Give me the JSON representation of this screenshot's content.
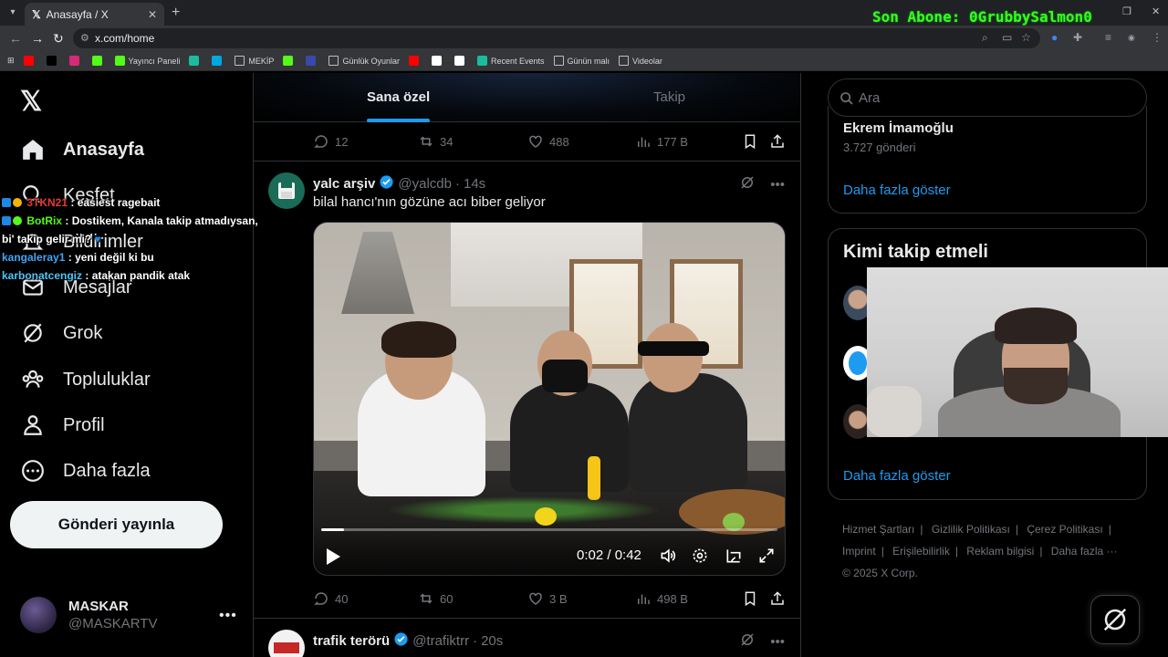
{
  "browser": {
    "tab_title": "Anasayfa / X",
    "url": "x.com/home",
    "overlay_text": "Son Abone: 0GrubbySalmon0",
    "bookmarks": [
      {
        "icon": "youtube-icon",
        "label": "",
        "color": "#ff0000"
      },
      {
        "icon": "x-icon",
        "label": "",
        "color": "#000000"
      },
      {
        "icon": "instagram-icon",
        "label": "",
        "color": "#d62976"
      },
      {
        "icon": "kick-icon",
        "label": "",
        "color": "#53fc18"
      },
      {
        "icon": "kick-icon",
        "label": "Yayıncı Paneli",
        "color": "#53fc18"
      },
      {
        "icon": "app-icon",
        "label": "",
        "color": "#1abc9c"
      },
      {
        "icon": "prime-icon",
        "label": "",
        "color": "#00a8e1"
      },
      {
        "icon": "folder-icon",
        "label": "MEKİP",
        "color": "#bdbdbd"
      },
      {
        "icon": "kick-icon",
        "label": "",
        "color": "#53fc18"
      },
      {
        "icon": "app-icon",
        "label": "",
        "color": "#3949ab"
      },
      {
        "icon": "folder-icon",
        "label": "Günlük Oyunlar",
        "color": "#bdbdbd"
      },
      {
        "icon": "youtube-icon",
        "label": "",
        "color": "#ff0000"
      },
      {
        "icon": "image-icon",
        "label": "",
        "color": "#ffffff"
      },
      {
        "icon": "openai-icon",
        "label": "",
        "color": "#ffffff"
      },
      {
        "icon": "app-icon",
        "label": "Recent Events",
        "color": "#1abc9c"
      },
      {
        "icon": "folder-icon",
        "label": "Günün malı",
        "color": "#bdbdbd"
      },
      {
        "icon": "folder-icon",
        "label": "Videolar",
        "color": "#bdbdbd"
      }
    ]
  },
  "nav": {
    "items": [
      {
        "label": "Anasayfa",
        "icon": "home-icon"
      },
      {
        "label": "Keşfet",
        "icon": "search-icon"
      },
      {
        "label": "Bildirimler",
        "icon": "bell-icon"
      },
      {
        "label": "Mesajlar",
        "icon": "mail-icon"
      },
      {
        "label": "Grok",
        "icon": "grok-icon"
      },
      {
        "label": "Topluluklar",
        "icon": "communities-icon"
      },
      {
        "label": "Profil",
        "icon": "person-icon"
      },
      {
        "label": "Daha fazla",
        "icon": "more-circle-icon"
      }
    ],
    "post_button": "Gönderi yayınla",
    "account": {
      "name": "MASKAR",
      "handle": "@MASKARTV"
    }
  },
  "chat": [
    {
      "user": "3TKN21",
      "user_color": "#e53935",
      "message": ": easiest ragebait"
    },
    {
      "user": "BotRix",
      "user_color": "#53fc18",
      "message": ": Dostikem, Kanala takip atmadıysan, bi' takip gelir mi?"
    },
    {
      "user": "kangaleray1",
      "user_color": "#42a5f5",
      "message": ": yeni değil ki bu"
    },
    {
      "user": "karbonatcengiz",
      "user_color": "#4fc3f7",
      "message": ": atakan pandik atak"
    }
  ],
  "feed": {
    "tabs": [
      "Sana özel",
      "Takip"
    ],
    "prev_actions": {
      "replies": "12",
      "reposts": "34",
      "likes": "488",
      "views": "177 B"
    },
    "post1": {
      "name": "yalc arşiv",
      "handle": "@yalcdb",
      "time": "14s",
      "text": "bilal hancı'nın gözüne acı biber geliyor",
      "video": {
        "time": "0:02 / 0:42",
        "progress": 0.05
      },
      "actions": {
        "replies": "40",
        "reposts": "60",
        "likes": "3 B",
        "views": "498 B"
      }
    },
    "post2": {
      "name": "trafik terörü",
      "handle": "@trafiktrr",
      "time": "20s"
    }
  },
  "sidebar": {
    "search_placeholder": "Ara",
    "trend": {
      "name": "Ekrem İmamoğlu",
      "count": "3.727 gönderi"
    },
    "show_more": "Daha fazla göster",
    "who_to_follow_title": "Kimi takip etmeli",
    "footer_links": [
      "Hizmet Şartları",
      "Gizlilik Politikası",
      "Çerez Politikası",
      "Imprint",
      "Erişilebilirlik",
      "Reklam bilgisi",
      "Daha fazla ···"
    ],
    "copyright": "© 2025 X Corp."
  },
  "colors": {
    "accent": "#1d9bf0",
    "verified": "#1d9bf0",
    "muted": "#71767b"
  }
}
